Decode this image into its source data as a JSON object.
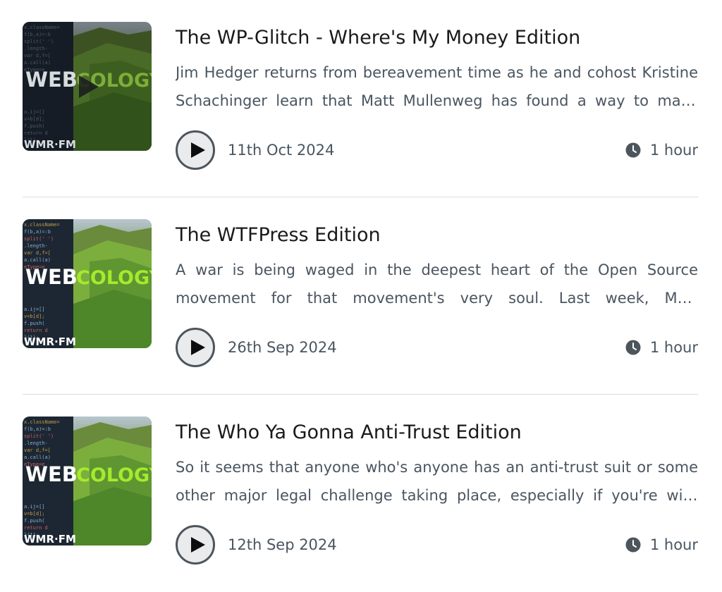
{
  "episodes": [
    {
      "title": "The WP-Glitch - Where's My Money Edition",
      "description": "Jim Hedger returns from bereavement time as he and cohost Kristine Schachinger learn that Matt Mullenweg has found a way to make things even worse for the WordPress community.",
      "date": "11th Oct 2024",
      "duration": "1 hour",
      "thumb_text_left": "WEB",
      "thumb_text_right": "COLOGY",
      "thumb_station": "WMR·FM",
      "thumb_variant": "dim"
    },
    {
      "title": "The WTFPress Edition",
      "description": "A war is being waged in the deepest heart of the Open Source movement for that movement's very soul. Last week, Matt Mullenweg, the original co-founder of WordPress, launched an attack.",
      "date": "26th Sep 2024",
      "duration": "1 hour",
      "thumb_text_left": "WEB",
      "thumb_text_right": "COLOGY",
      "thumb_station": "WMR·FM",
      "thumb_variant": "bright"
    },
    {
      "title": "The Who Ya Gonna Anti-Trust Edition",
      "description": "So it seems that anyone who's anyone has an anti-trust suit or some other major legal challenge taking place, especially if you're with Apple or Google these days.",
      "date": "12th Sep 2024",
      "duration": "1 hour",
      "thumb_text_left": "WEB",
      "thumb_text_right": "COLOGY",
      "thumb_station": "WMR·FM",
      "thumb_variant": "bright"
    }
  ],
  "icons": {
    "play": "play-icon",
    "clock": "clock-icon"
  },
  "colors": {
    "text_title": "#1a1a1a",
    "text_muted": "#4a5560",
    "divider": "#dcdcdc",
    "logo_green": "#9be22a",
    "logo_white": "#ffffff"
  }
}
